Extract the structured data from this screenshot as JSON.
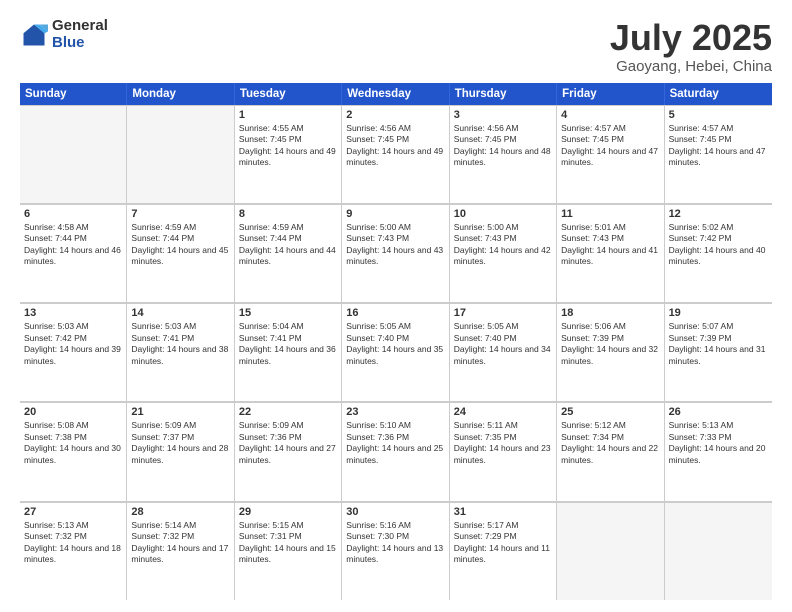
{
  "logo": {
    "general": "General",
    "blue": "Blue"
  },
  "title": "July 2025",
  "subtitle": "Gaoyang, Hebei, China",
  "headers": [
    "Sunday",
    "Monday",
    "Tuesday",
    "Wednesday",
    "Thursday",
    "Friday",
    "Saturday"
  ],
  "rows": [
    [
      {
        "day": "",
        "sunrise": "",
        "sunset": "",
        "daylight": "",
        "empty": true
      },
      {
        "day": "",
        "sunrise": "",
        "sunset": "",
        "daylight": "",
        "empty": true
      },
      {
        "day": "1",
        "sunrise": "Sunrise: 4:55 AM",
        "sunset": "Sunset: 7:45 PM",
        "daylight": "Daylight: 14 hours and 49 minutes.",
        "empty": false
      },
      {
        "day": "2",
        "sunrise": "Sunrise: 4:56 AM",
        "sunset": "Sunset: 7:45 PM",
        "daylight": "Daylight: 14 hours and 49 minutes.",
        "empty": false
      },
      {
        "day": "3",
        "sunrise": "Sunrise: 4:56 AM",
        "sunset": "Sunset: 7:45 PM",
        "daylight": "Daylight: 14 hours and 48 minutes.",
        "empty": false
      },
      {
        "day": "4",
        "sunrise": "Sunrise: 4:57 AM",
        "sunset": "Sunset: 7:45 PM",
        "daylight": "Daylight: 14 hours and 47 minutes.",
        "empty": false
      },
      {
        "day": "5",
        "sunrise": "Sunrise: 4:57 AM",
        "sunset": "Sunset: 7:45 PM",
        "daylight": "Daylight: 14 hours and 47 minutes.",
        "empty": false
      }
    ],
    [
      {
        "day": "6",
        "sunrise": "Sunrise: 4:58 AM",
        "sunset": "Sunset: 7:44 PM",
        "daylight": "Daylight: 14 hours and 46 minutes.",
        "empty": false
      },
      {
        "day": "7",
        "sunrise": "Sunrise: 4:59 AM",
        "sunset": "Sunset: 7:44 PM",
        "daylight": "Daylight: 14 hours and 45 minutes.",
        "empty": false
      },
      {
        "day": "8",
        "sunrise": "Sunrise: 4:59 AM",
        "sunset": "Sunset: 7:44 PM",
        "daylight": "Daylight: 14 hours and 44 minutes.",
        "empty": false
      },
      {
        "day": "9",
        "sunrise": "Sunrise: 5:00 AM",
        "sunset": "Sunset: 7:43 PM",
        "daylight": "Daylight: 14 hours and 43 minutes.",
        "empty": false
      },
      {
        "day": "10",
        "sunrise": "Sunrise: 5:00 AM",
        "sunset": "Sunset: 7:43 PM",
        "daylight": "Daylight: 14 hours and 42 minutes.",
        "empty": false
      },
      {
        "day": "11",
        "sunrise": "Sunrise: 5:01 AM",
        "sunset": "Sunset: 7:43 PM",
        "daylight": "Daylight: 14 hours and 41 minutes.",
        "empty": false
      },
      {
        "day": "12",
        "sunrise": "Sunrise: 5:02 AM",
        "sunset": "Sunset: 7:42 PM",
        "daylight": "Daylight: 14 hours and 40 minutes.",
        "empty": false
      }
    ],
    [
      {
        "day": "13",
        "sunrise": "Sunrise: 5:03 AM",
        "sunset": "Sunset: 7:42 PM",
        "daylight": "Daylight: 14 hours and 39 minutes.",
        "empty": false
      },
      {
        "day": "14",
        "sunrise": "Sunrise: 5:03 AM",
        "sunset": "Sunset: 7:41 PM",
        "daylight": "Daylight: 14 hours and 38 minutes.",
        "empty": false
      },
      {
        "day": "15",
        "sunrise": "Sunrise: 5:04 AM",
        "sunset": "Sunset: 7:41 PM",
        "daylight": "Daylight: 14 hours and 36 minutes.",
        "empty": false
      },
      {
        "day": "16",
        "sunrise": "Sunrise: 5:05 AM",
        "sunset": "Sunset: 7:40 PM",
        "daylight": "Daylight: 14 hours and 35 minutes.",
        "empty": false
      },
      {
        "day": "17",
        "sunrise": "Sunrise: 5:05 AM",
        "sunset": "Sunset: 7:40 PM",
        "daylight": "Daylight: 14 hours and 34 minutes.",
        "empty": false
      },
      {
        "day": "18",
        "sunrise": "Sunrise: 5:06 AM",
        "sunset": "Sunset: 7:39 PM",
        "daylight": "Daylight: 14 hours and 32 minutes.",
        "empty": false
      },
      {
        "day": "19",
        "sunrise": "Sunrise: 5:07 AM",
        "sunset": "Sunset: 7:39 PM",
        "daylight": "Daylight: 14 hours and 31 minutes.",
        "empty": false
      }
    ],
    [
      {
        "day": "20",
        "sunrise": "Sunrise: 5:08 AM",
        "sunset": "Sunset: 7:38 PM",
        "daylight": "Daylight: 14 hours and 30 minutes.",
        "empty": false
      },
      {
        "day": "21",
        "sunrise": "Sunrise: 5:09 AM",
        "sunset": "Sunset: 7:37 PM",
        "daylight": "Daylight: 14 hours and 28 minutes.",
        "empty": false
      },
      {
        "day": "22",
        "sunrise": "Sunrise: 5:09 AM",
        "sunset": "Sunset: 7:36 PM",
        "daylight": "Daylight: 14 hours and 27 minutes.",
        "empty": false
      },
      {
        "day": "23",
        "sunrise": "Sunrise: 5:10 AM",
        "sunset": "Sunset: 7:36 PM",
        "daylight": "Daylight: 14 hours and 25 minutes.",
        "empty": false
      },
      {
        "day": "24",
        "sunrise": "Sunrise: 5:11 AM",
        "sunset": "Sunset: 7:35 PM",
        "daylight": "Daylight: 14 hours and 23 minutes.",
        "empty": false
      },
      {
        "day": "25",
        "sunrise": "Sunrise: 5:12 AM",
        "sunset": "Sunset: 7:34 PM",
        "daylight": "Daylight: 14 hours and 22 minutes.",
        "empty": false
      },
      {
        "day": "26",
        "sunrise": "Sunrise: 5:13 AM",
        "sunset": "Sunset: 7:33 PM",
        "daylight": "Daylight: 14 hours and 20 minutes.",
        "empty": false
      }
    ],
    [
      {
        "day": "27",
        "sunrise": "Sunrise: 5:13 AM",
        "sunset": "Sunset: 7:32 PM",
        "daylight": "Daylight: 14 hours and 18 minutes.",
        "empty": false
      },
      {
        "day": "28",
        "sunrise": "Sunrise: 5:14 AM",
        "sunset": "Sunset: 7:32 PM",
        "daylight": "Daylight: 14 hours and 17 minutes.",
        "empty": false
      },
      {
        "day": "29",
        "sunrise": "Sunrise: 5:15 AM",
        "sunset": "Sunset: 7:31 PM",
        "daylight": "Daylight: 14 hours and 15 minutes.",
        "empty": false
      },
      {
        "day": "30",
        "sunrise": "Sunrise: 5:16 AM",
        "sunset": "Sunset: 7:30 PM",
        "daylight": "Daylight: 14 hours and 13 minutes.",
        "empty": false
      },
      {
        "day": "31",
        "sunrise": "Sunrise: 5:17 AM",
        "sunset": "Sunset: 7:29 PM",
        "daylight": "Daylight: 14 hours and 11 minutes.",
        "empty": false
      },
      {
        "day": "",
        "sunrise": "",
        "sunset": "",
        "daylight": "",
        "empty": true
      },
      {
        "day": "",
        "sunrise": "",
        "sunset": "",
        "daylight": "",
        "empty": true
      }
    ]
  ]
}
